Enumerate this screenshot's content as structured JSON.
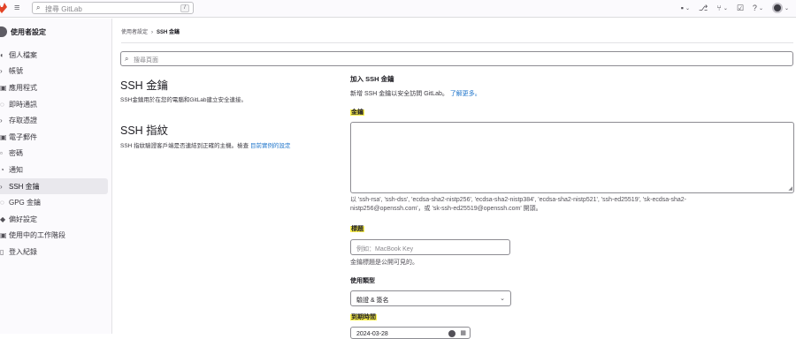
{
  "header": {
    "search_placeholder": "搜尋 GitLab",
    "search_shortcut": "/",
    "icons": [
      "issues-icon",
      "merge-requests-icon",
      "todo-icon",
      "help-icon",
      "user-avatar"
    ]
  },
  "sidebar": {
    "title": "使用者設定",
    "items": [
      {
        "label": "個人檔案",
        "icon": "profile-icon",
        "active": false
      },
      {
        "label": "帳號",
        "icon": "account-icon",
        "active": false
      },
      {
        "label": "應用程式",
        "icon": "applications-icon",
        "active": false
      },
      {
        "label": "即時通訊",
        "icon": "chat-icon",
        "active": false
      },
      {
        "label": "存取憑證",
        "icon": "token-icon",
        "active": false
      },
      {
        "label": "電子郵件",
        "icon": "email-icon",
        "active": false
      },
      {
        "label": "密碼",
        "icon": "lock-icon",
        "active": false
      },
      {
        "label": "通知",
        "icon": "notifications-icon",
        "active": false
      },
      {
        "label": "SSH 金鑰",
        "icon": "key-icon",
        "active": true
      },
      {
        "label": "GPG 金鑰",
        "icon": "gpg-key-icon",
        "active": false
      },
      {
        "label": "偏好設定",
        "icon": "preferences-icon",
        "active": false
      },
      {
        "label": "使用中的工作階段",
        "icon": "sessions-icon",
        "active": false
      },
      {
        "label": "登入紀錄",
        "icon": "log-icon",
        "active": false
      }
    ]
  },
  "breadcrumb": {
    "parent": "使用者設定",
    "separator": "›",
    "current": "SSH 金鑰"
  },
  "page_search": {
    "placeholder": "搜尋頁面"
  },
  "ssh_keys_section": {
    "title": "SSH 金鑰",
    "description": "SSH金鑰用於在您的電腦和GitLab建立安全連接。"
  },
  "ssh_fingerprint_section": {
    "title": "SSH 指紋",
    "description": "SSH 指紋驗證客戶端是否連結到正確的主機。檢查",
    "link": "目前實例的設定"
  },
  "add_key": {
    "title": "加入 SSH 金鑰",
    "subtitle": "新增 SSH 金鑰以安全訪問 GitLab。",
    "learn_more": "了解更多。",
    "key_label": "金鑰",
    "key_value": "",
    "key_hint_line1": "以 'ssh-rsa', 'ssh-dss', 'ecdsa-sha2-nistp256', 'ecdsa-sha2-nistp384', 'ecdsa-sha2-nistp521', 'ssh-ed25519', 'sk-ecdsa-sha2-",
    "key_hint_line2": "nistp256@openssh.com'，或 'sk-ssh-ed25519@openssh.com' 開頭。",
    "title_label": "標題",
    "title_placeholder": "例如：MacBook Key",
    "title_hint": "金鑰標題是公開可見的。",
    "usage_label": "使用類型",
    "usage_value": "驗證 & 簽名",
    "expires_label": "到期時間",
    "expires_value": "2024-03-28"
  },
  "colors": {
    "highlight": "#fdf24c",
    "link": "#1f75cb",
    "active_nav_bg": "#e9e8ed"
  }
}
